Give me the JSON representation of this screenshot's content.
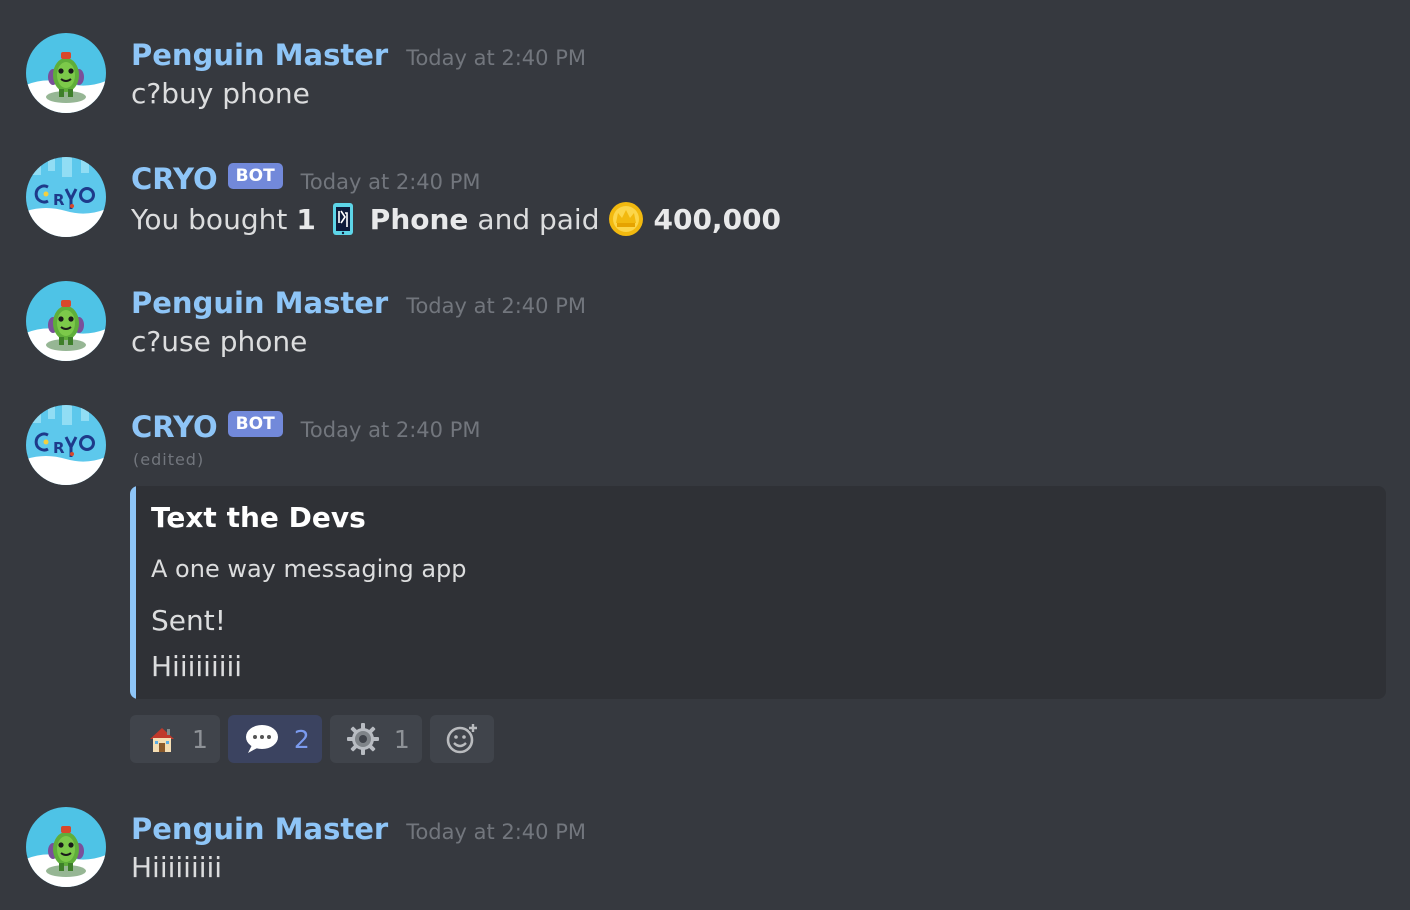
{
  "colors": {
    "background": "#36393f",
    "username": "#8ec5f7",
    "bot_tag": "#7289da",
    "timestamp": "#72767d",
    "embed_bg": "#2f3136",
    "embed_accent": "#8ec5f7",
    "reaction_bg": "#40444b",
    "reaction_active_bg": "#3b4360"
  },
  "messages": [
    {
      "author": "Penguin Master",
      "timestamp": "Today at 2:40 PM",
      "avatar_icon": "cactus-avatar-icon",
      "text": "c?buy phone"
    },
    {
      "author": "CRYO",
      "bot_tag": "BOT",
      "timestamp": "Today at 2:40 PM",
      "avatar_icon": "cryo-logo-avatar-icon",
      "segments": {
        "t1": "You bought",
        "qty": "1",
        "item_icon": "phone-icon",
        "item": "Phone",
        "t2": "and paid",
        "coin_icon": "coin-icon",
        "amount": "400,000"
      }
    },
    {
      "author": "Penguin Master",
      "timestamp": "Today at 2:40 PM",
      "avatar_icon": "cactus-avatar-icon",
      "text": "c?use phone"
    },
    {
      "author": "CRYO",
      "bot_tag": "BOT",
      "timestamp": "Today at 2:40 PM",
      "avatar_icon": "cryo-logo-avatar-icon",
      "edited": "(edited)",
      "embed": {
        "title": "Text the Devs",
        "description": "A one way messaging app",
        "line1": "Sent!",
        "line2": "Hiiiiiiiii"
      },
      "reactions": [
        {
          "icon": "house-icon",
          "count": "1",
          "active": false
        },
        {
          "icon": "speech-bubble-icon",
          "count": "2",
          "active": true
        },
        {
          "icon": "gear-icon",
          "count": "1",
          "active": false
        }
      ],
      "add_reaction_icon": "add-reaction-icon"
    },
    {
      "author": "Penguin Master",
      "timestamp": "Today at 2:40 PM",
      "avatar_icon": "cactus-avatar-icon",
      "text": "Hiiiiiiiii"
    }
  ]
}
